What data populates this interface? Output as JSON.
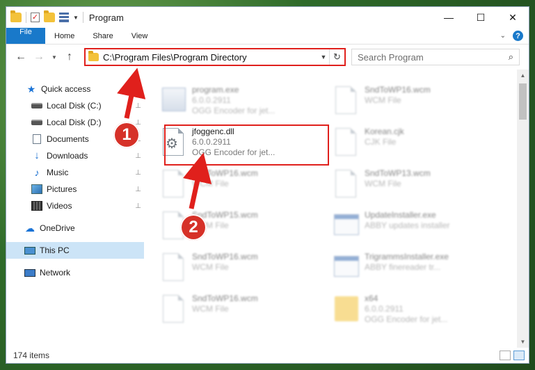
{
  "window": {
    "title": "Program",
    "controls": {
      "minimize": "—",
      "maximize": "☐",
      "close": "✕"
    }
  },
  "ribbon": {
    "tabs": [
      {
        "label": "File",
        "active": true
      },
      {
        "label": "Home"
      },
      {
        "label": "Share"
      },
      {
        "label": "View"
      }
    ]
  },
  "address": {
    "path": "C:\\Program Files\\Program Directory",
    "search_placeholder": "Search Program"
  },
  "sidebar": {
    "items": [
      {
        "label": "Quick access",
        "icon": "star-icon"
      },
      {
        "label": "Local Disk (C:)",
        "icon": "drive-icon",
        "pinned": true
      },
      {
        "label": "Local Disk (D:)",
        "icon": "drive-icon",
        "pinned": true
      },
      {
        "label": "Documents",
        "icon": "documents-icon",
        "pinned": true
      },
      {
        "label": "Downloads",
        "icon": "downloads-icon",
        "pinned": true
      },
      {
        "label": "Music",
        "icon": "music-icon",
        "pinned": true
      },
      {
        "label": "Pictures",
        "icon": "pictures-icon",
        "pinned": true
      },
      {
        "label": "Videos",
        "icon": "videos-icon",
        "pinned": true
      },
      {
        "label": "OneDrive",
        "icon": "onedrive-icon"
      },
      {
        "label": "This PC",
        "icon": "pc-icon",
        "selected": true
      },
      {
        "label": "Network",
        "icon": "network-icon"
      }
    ]
  },
  "files": [
    {
      "name": "program.exe",
      "line2": "6.0.0.2911",
      "line3": "OGG Encoder for jet...",
      "icon": "exe-icon",
      "blurred": true
    },
    {
      "name": "SndToWP16.wcm",
      "line2": "WCM File",
      "line3": "",
      "icon": "file-icon",
      "blurred": true
    },
    {
      "name": "jfoggenc.dll",
      "line2": "6.0.0.2911",
      "line3": "OGG Encoder for jet...",
      "icon": "dll-icon",
      "blurred": false
    },
    {
      "name": "Korean.cjk",
      "line2": "CJK File",
      "line3": "",
      "icon": "file-icon",
      "blurred": true
    },
    {
      "name": "SndToWP16.wcm",
      "line2": "WCM File",
      "line3": "",
      "icon": "file-icon",
      "blurred": true
    },
    {
      "name": "SndToWP13.wcm",
      "line2": "WCM File",
      "line3": "",
      "icon": "file-icon",
      "blurred": true
    },
    {
      "name": "SndToWP15.wcm",
      "line2": "WCM File",
      "line3": "",
      "icon": "file-icon",
      "blurred": true
    },
    {
      "name": "UpdateInstaller.exe",
      "line2": "ABBY updates installer",
      "line3": "",
      "icon": "window-icon",
      "blurred": true
    },
    {
      "name": "SndToWP16.wcm",
      "line2": "WCM File",
      "line3": "",
      "icon": "file-icon",
      "blurred": true
    },
    {
      "name": "TrigrammsInstaller.exe",
      "line2": "ABBY finereader tr...",
      "line3": "",
      "icon": "window-icon",
      "blurred": true
    },
    {
      "name": "SndToWP16.wcm",
      "line2": "WCM File",
      "line3": "",
      "icon": "file-icon",
      "blurred": true
    },
    {
      "name": "x64",
      "line2": "6.0.0.2911",
      "line3": "OGG Encoder for jet...",
      "icon": "folder-icon",
      "blurred": true
    }
  ],
  "status": {
    "item_count": "174 items"
  },
  "annotations": [
    {
      "number": "1"
    },
    {
      "number": "2"
    }
  ],
  "colors": {
    "accent": "#1979ca",
    "annotation": "#e0201c"
  }
}
